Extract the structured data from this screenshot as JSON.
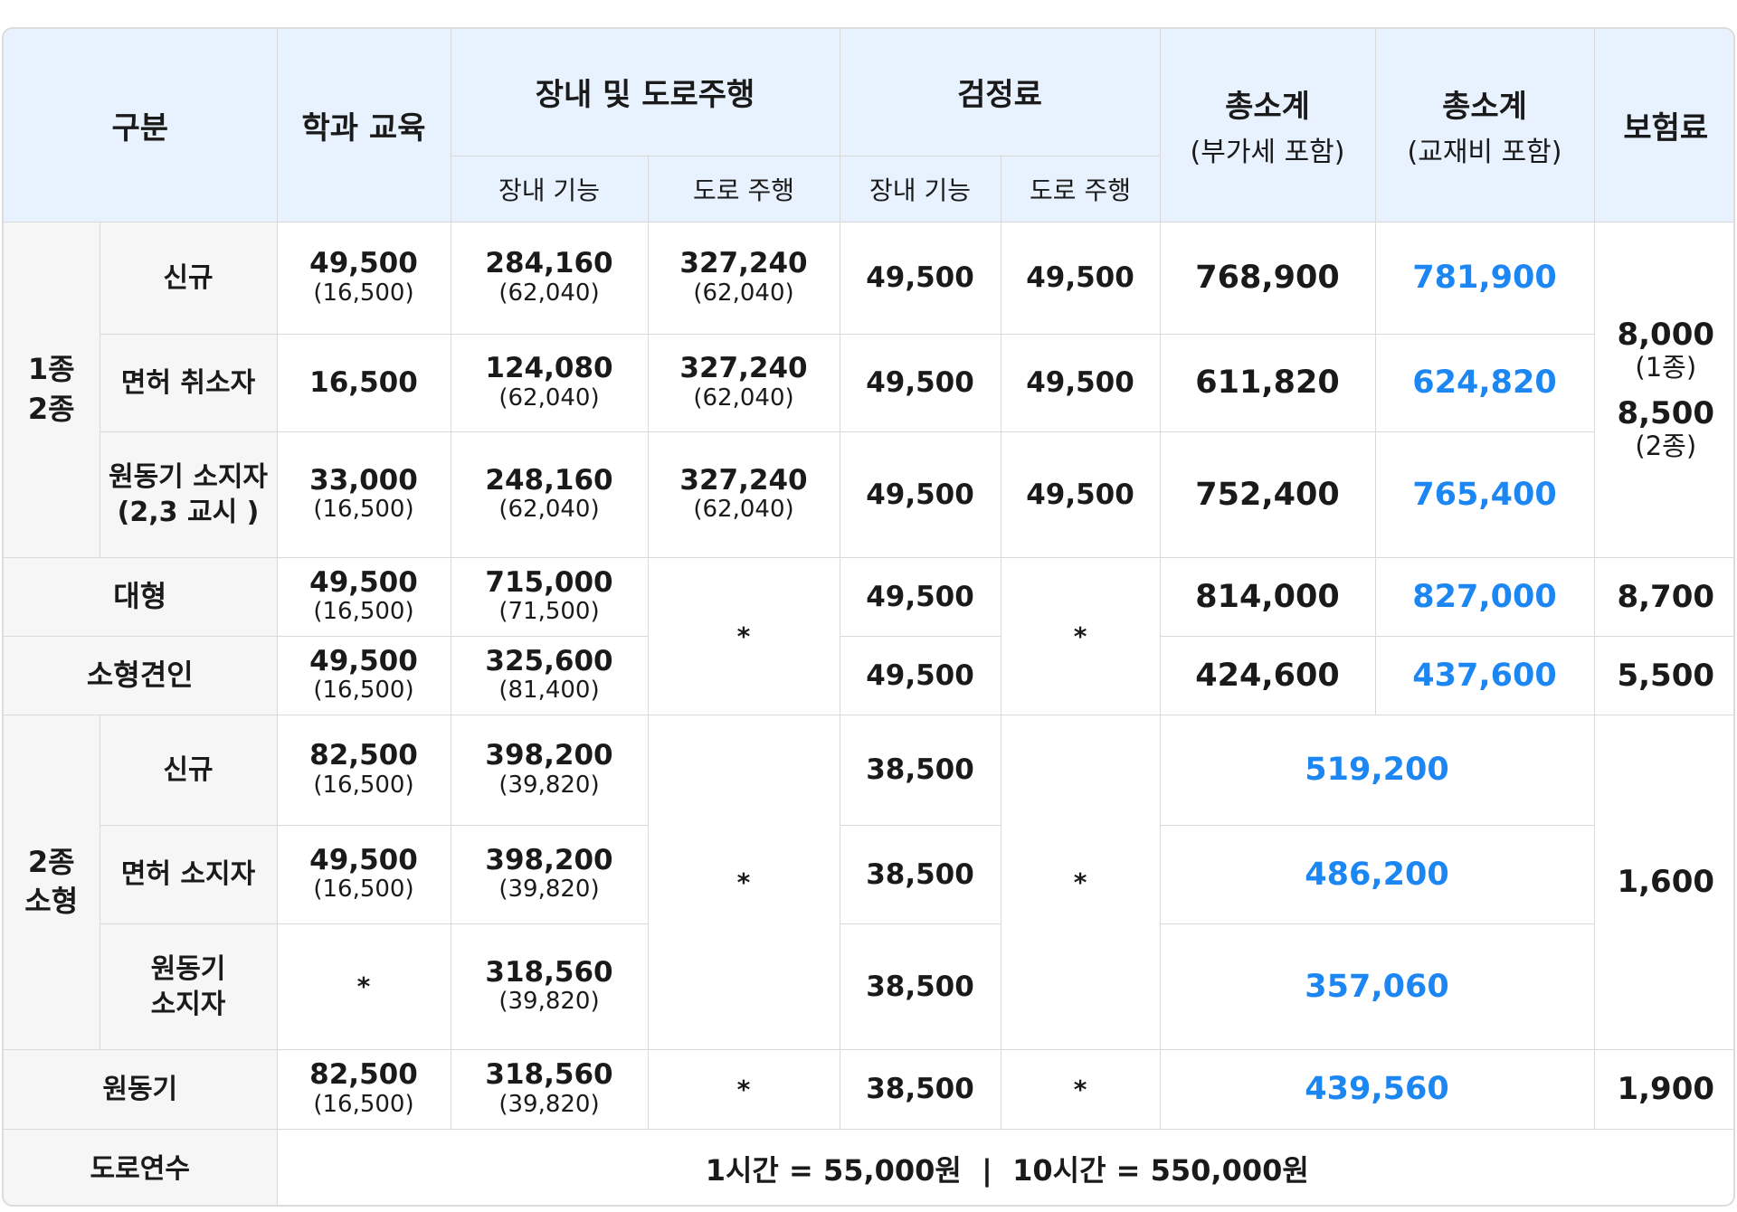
{
  "header": {
    "category": "구분",
    "theory": "학과 교육",
    "driving": "장내 및 도로주행",
    "driving_course": "장내 기능",
    "driving_road": "도로 주행",
    "exam": "검정료",
    "exam_course": "장내 기능",
    "exam_road": "도로 주행",
    "total_vat": "총소계",
    "total_vat_sub": "(부가세 포함)",
    "total_book": "총소계",
    "total_book_sub": "(교재비 포함)",
    "insurance": "보험료"
  },
  "group1": {
    "label_line1": "1종",
    "label_line2": "2종",
    "insurance": {
      "v1": "8,000",
      "p1": "(1종)",
      "v2": "8,500",
      "p2": "(2종)"
    },
    "rows": [
      {
        "label": "신규",
        "label2": "",
        "theory": "49,500",
        "theory_p": "(16,500)",
        "course": "284,160",
        "course_p": "(62,040)",
        "road": "327,240",
        "road_p": "(62,040)",
        "exam_course": "49,500",
        "exam_road": "49,500",
        "total_vat": "768,900",
        "total_book": "781,900"
      },
      {
        "label": "면허 취소자",
        "label2": "",
        "theory": "16,500",
        "theory_p": "",
        "course": "124,080",
        "course_p": "(62,040)",
        "road": "327,240",
        "road_p": "(62,040)",
        "exam_course": "49,500",
        "exam_road": "49,500",
        "total_vat": "611,820",
        "total_book": "624,820"
      },
      {
        "label": "원동기 소지자",
        "label2": "(2,3 교시 )",
        "theory": "33,000",
        "theory_p": "(16,500)",
        "course": "248,160",
        "course_p": "(62,040)",
        "road": "327,240",
        "road_p": "(62,040)",
        "exam_course": "49,500",
        "exam_road": "49,500",
        "total_vat": "752,400",
        "total_book": "765,400"
      }
    ]
  },
  "large": {
    "label": "대형",
    "theory": "49,500",
    "theory_p": "(16,500)",
    "course": "715,000",
    "course_p": "(71,500)",
    "exam_course": "49,500",
    "total_vat": "814,000",
    "total_book": "827,000",
    "insurance": "8,700"
  },
  "tow": {
    "label": "소형견인",
    "theory": "49,500",
    "theory_p": "(16,500)",
    "course": "325,600",
    "course_p": "(81,400)",
    "exam_course": "49,500",
    "total_vat": "424,600",
    "total_book": "437,600",
    "insurance": "5,500"
  },
  "asterisk": "*",
  "group2": {
    "label_line1": "2종",
    "label_line2": "소형",
    "insurance": "1,600",
    "rows": [
      {
        "label": "신규",
        "label2": "",
        "theory": "82,500",
        "theory_p": "(16,500)",
        "course": "398,200",
        "course_p": "(39,820)",
        "exam_course": "38,500",
        "total": "519,200"
      },
      {
        "label": "면허 소지자",
        "label2": "",
        "theory": "49,500",
        "theory_p": "(16,500)",
        "course": "398,200",
        "course_p": "(39,820)",
        "exam_course": "38,500",
        "total": "486,200"
      },
      {
        "label": "원동기",
        "label2": "소지자",
        "theory": "*",
        "theory_p": "",
        "course": "318,560",
        "course_p": "(39,820)",
        "exam_course": "38,500",
        "total": "357,060"
      }
    ]
  },
  "moped": {
    "label": "원동기",
    "theory": "82,500",
    "theory_p": "(16,500)",
    "course": "318,560",
    "course_p": "(39,820)",
    "exam_course": "38,500",
    "total": "439,560",
    "insurance": "1,900"
  },
  "road_training": {
    "label": "도로연수",
    "text": "1시간 = 55,000원  |  10시간 = 550,000원"
  }
}
